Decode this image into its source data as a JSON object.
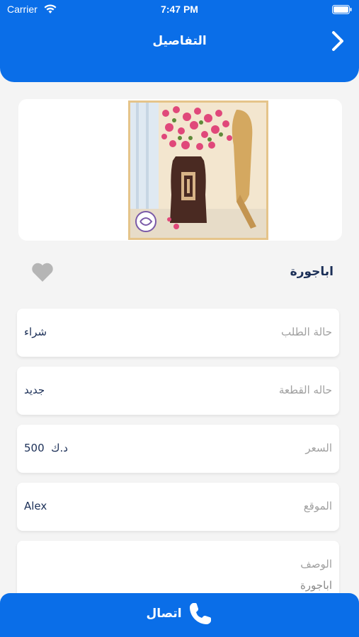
{
  "status_bar": {
    "carrier": "Carrier",
    "time": "7:47 PM"
  },
  "header": {
    "title": "التفاصيل",
    "back_icon": "chevron-right-icon"
  },
  "product": {
    "name": "اباجورة",
    "favorite_icon": "heart-icon"
  },
  "details": [
    {
      "label": "حالة الطلب",
      "value": "شراء"
    },
    {
      "label": "حاله القطعة",
      "value": "جديد"
    },
    {
      "label": "السعر",
      "value": "500  د.ك"
    },
    {
      "label": "الموقع",
      "value": "Alex"
    }
  ],
  "description": {
    "label": "الوصف",
    "text": "اباجورة"
  },
  "call_button": {
    "label": "اتصال",
    "icon": "phone-icon"
  },
  "colors": {
    "primary": "#0a6ee8",
    "text_dark": "#1b2f57",
    "label_gray": "#a0a0a0"
  }
}
